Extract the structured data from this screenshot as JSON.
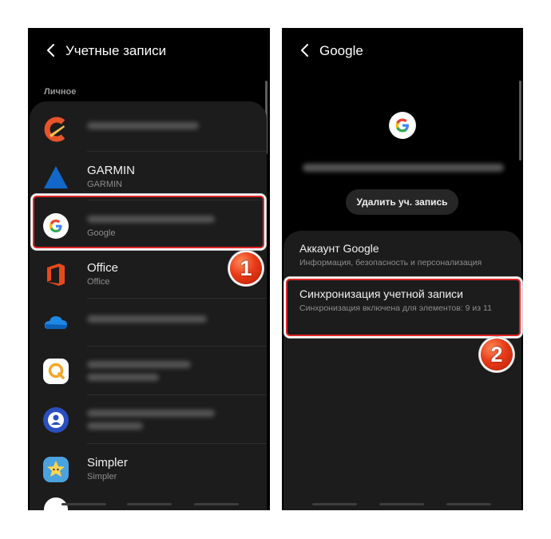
{
  "left_screen": {
    "title": "Учетные записи",
    "section_label": "Личное",
    "accounts": [
      {
        "name": "",
        "sub": "",
        "icon": "ccleaner-icon"
      },
      {
        "name": "GARMIN",
        "sub": "GARMIN",
        "icon": "garmin-icon"
      },
      {
        "name": "",
        "sub": "Google",
        "icon": "google-icon"
      },
      {
        "name": "Office",
        "sub": "Office",
        "icon": "office-icon"
      },
      {
        "name": "",
        "sub": "",
        "icon": "onedrive-icon"
      },
      {
        "name": "",
        "sub": "",
        "icon": "qip-icon"
      },
      {
        "name": "",
        "sub": "",
        "icon": "account-icon"
      },
      {
        "name": "Simpler",
        "sub": "Simpler",
        "icon": "simpler-icon"
      }
    ],
    "callout": "1"
  },
  "right_screen": {
    "title": "Google",
    "remove_button": "Удалить уч. запись",
    "menu": [
      {
        "title": "Аккаунт Google",
        "sub": "Информация, безопасность и персонализация"
      },
      {
        "title": "Синхронизация учетной записи",
        "sub": "Синхронизация включена для элементов: 9 из 11"
      }
    ],
    "callout": "2"
  },
  "colors": {
    "background": "#000000",
    "card": "#1c1c1c",
    "highlight": "#e02626",
    "badge": "#e83c18"
  }
}
